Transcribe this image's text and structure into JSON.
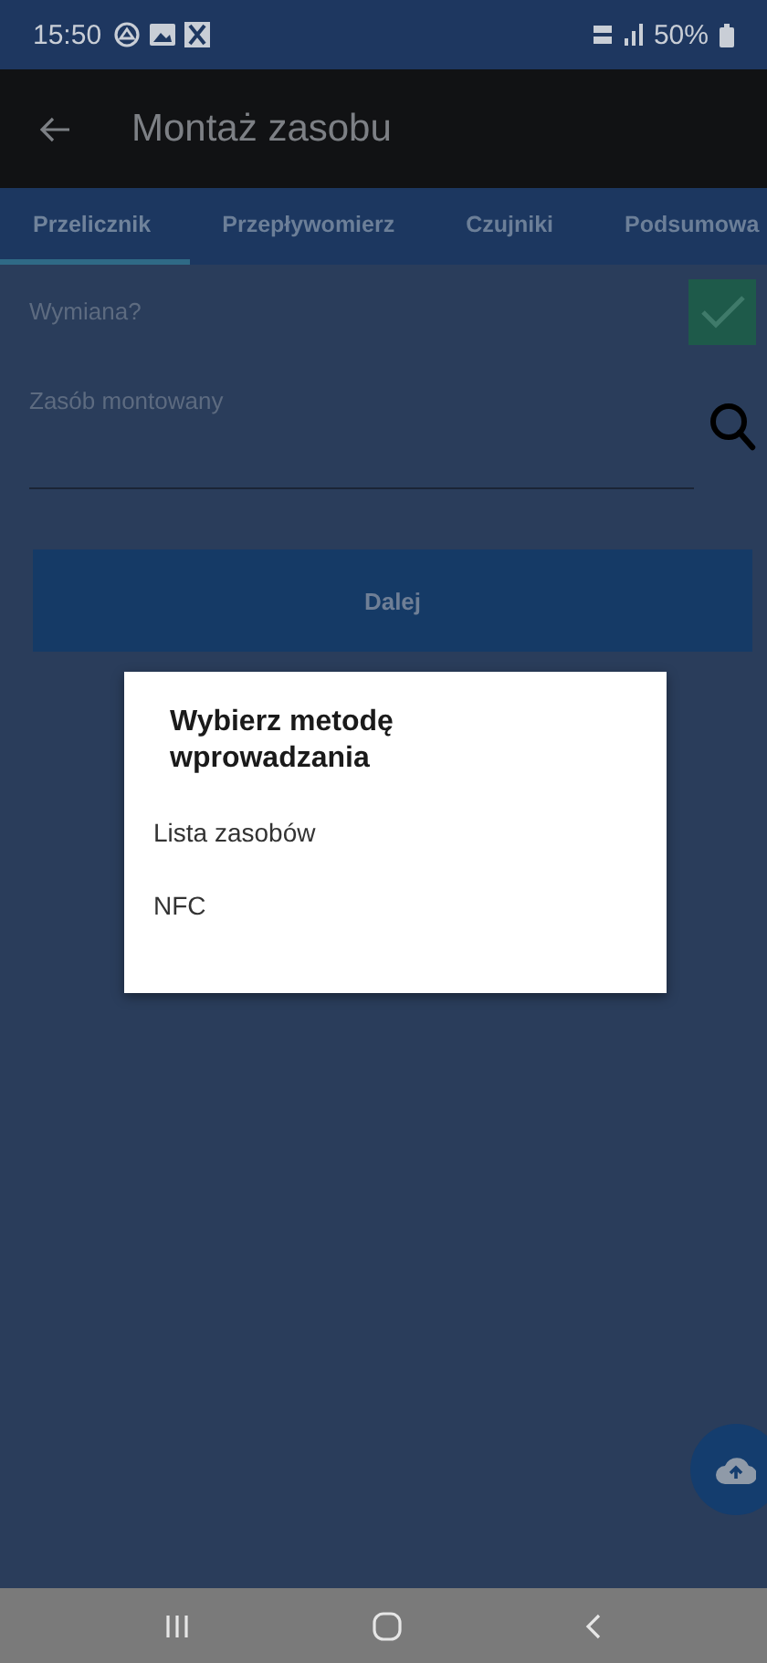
{
  "status_bar": {
    "time": "15:50",
    "battery": "50%"
  },
  "app_bar": {
    "title": "Montaż zasobu"
  },
  "tabs": [
    {
      "label": "Przelicznik",
      "selected": true
    },
    {
      "label": "Przepływomierz",
      "selected": false
    },
    {
      "label": "Czujniki",
      "selected": false
    },
    {
      "label": "Podsumowa",
      "selected": false
    }
  ],
  "form": {
    "exchange": {
      "label": "Wymiana?",
      "checked": true
    },
    "asset_field": {
      "placeholder": "Zasób montowany"
    },
    "next_button": "Dalej"
  },
  "dialog": {
    "title": "Wybierz metodę wprowadzania",
    "options": [
      "Lista zasobów",
      "NFC"
    ]
  }
}
